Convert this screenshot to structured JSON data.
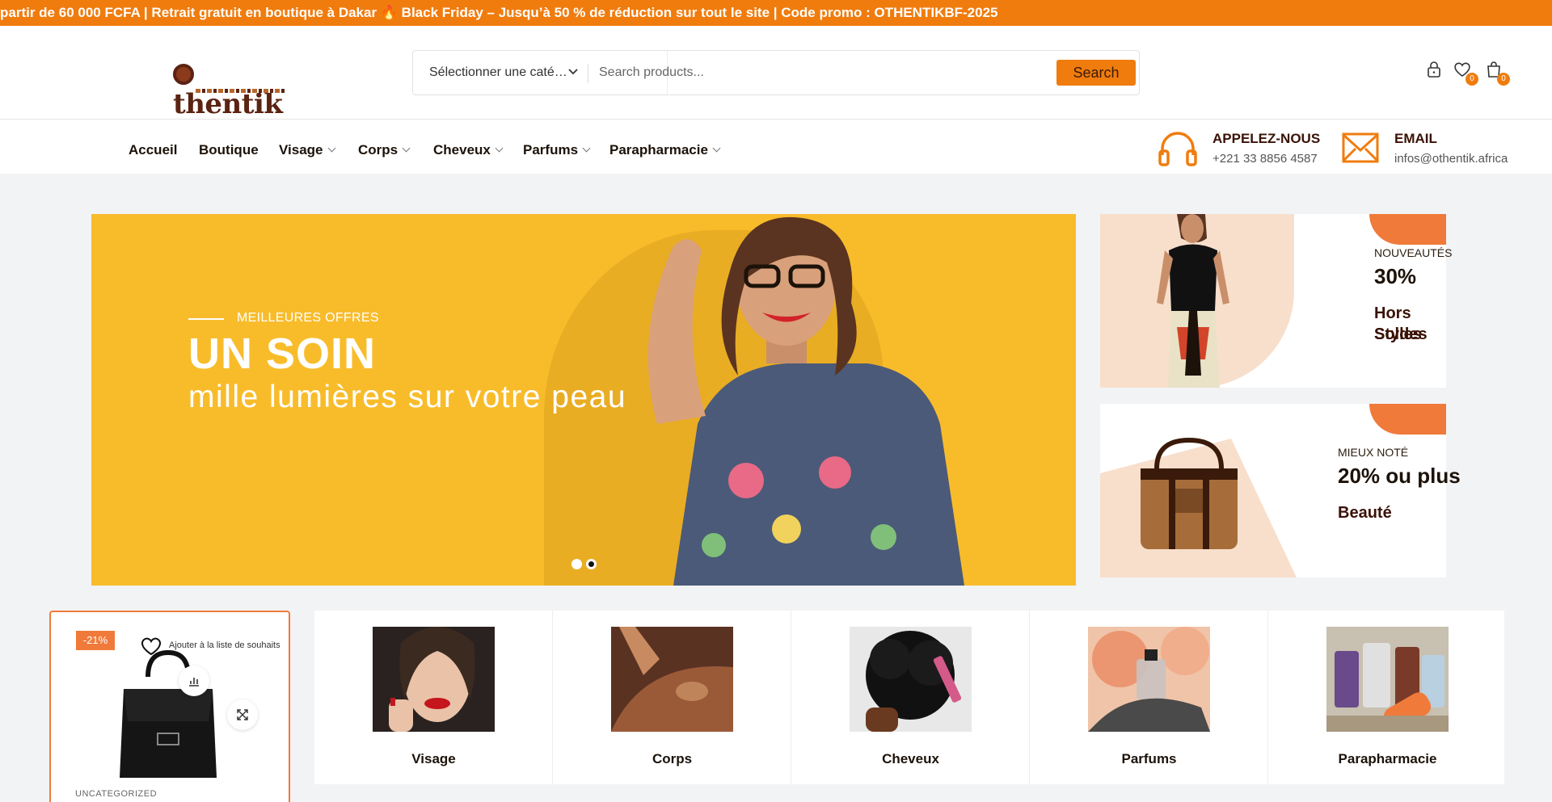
{
  "announcement": "partir de 60 000 FCFA | Retrait gratuit en boutique à Dakar 🔥 Black Friday – Jusqu’à 50 % de réduction sur tout le site | Code promo : OTHENTIKBF-2025",
  "logo": {
    "text": "thentik"
  },
  "search": {
    "category_label": "Sélectionner une caté…",
    "placeholder": "Search products...",
    "button_label": "Search"
  },
  "header_icons": {
    "wishlist_count": "0",
    "cart_count": "0"
  },
  "nav": {
    "items": [
      "Accueil",
      "Boutique",
      "Visage",
      "Corps",
      "Cheveux",
      "Parfums",
      "Parapharmacie"
    ]
  },
  "contact": {
    "phone_title": "APPELEZ-NOUS",
    "phone_value": "+221 33 8856 4587",
    "email_title": "EMAIL",
    "email_value": "infos@othentik.africa"
  },
  "hero": {
    "tagline": "MEILLEURES OFFRES",
    "title": "UN SOIN",
    "subtitle": "mille lumières sur votre peau"
  },
  "promos": [
    {
      "label": "NOUVEAUTÉS",
      "big": "30%",
      "desc_line1": "Hors Soldes",
      "desc_line2": "Styles"
    },
    {
      "label": "MIEUX NOTÉ",
      "big": "20% ou plus",
      "desc_line1": "Beauté",
      "desc_line2": ""
    }
  ],
  "product": {
    "badge": "-21%",
    "wishlist_text": "Ajouter à la liste de souhaits",
    "category": "UNCATEGORIZED"
  },
  "categories": [
    "Visage",
    "Corps",
    "Cheveux",
    "Parfums",
    "Parapharmacie"
  ],
  "colors": {
    "accent": "#f07c0e",
    "hero_bg": "#f8bc2b",
    "brand_dark": "#5a2312"
  }
}
